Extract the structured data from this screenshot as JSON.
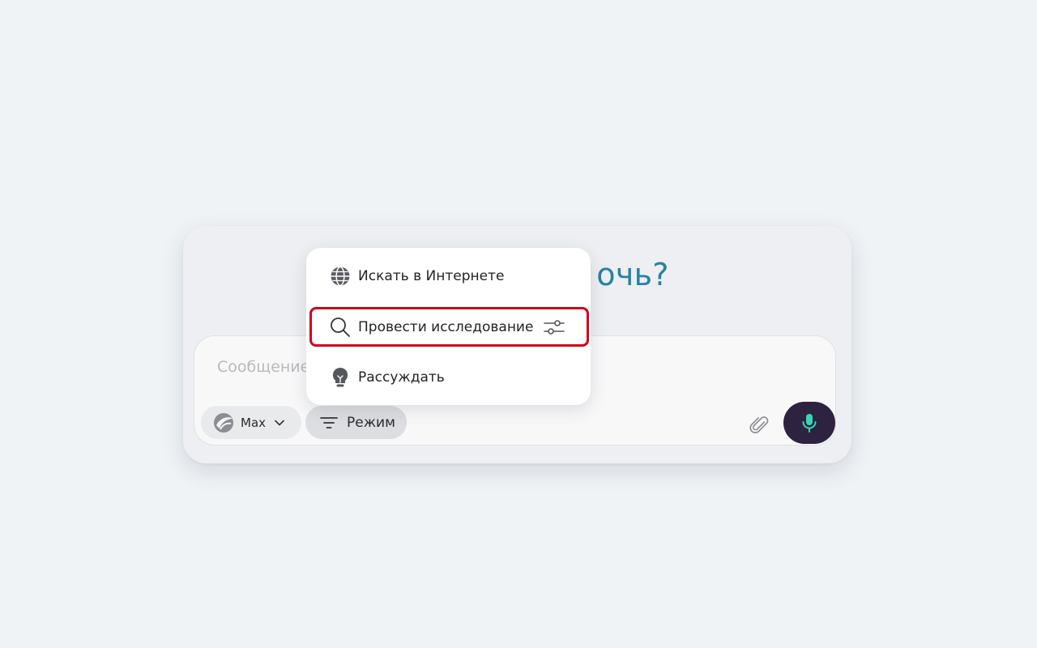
{
  "chat": {
    "headline": "очь?",
    "message_placeholder": "Сообщение",
    "model_label": "Max",
    "mode_label": "Режим"
  },
  "mode_menu": {
    "items": [
      {
        "label": "Искать в Интернете",
        "icon": "globe-icon"
      },
      {
        "label": "Провести исследование",
        "icon": "search-icon",
        "extra_icon": "settings-sliders-icon",
        "highlighted": true
      },
      {
        "label": "Рассуждать",
        "icon": "lightbulb-icon"
      }
    ]
  },
  "colors": {
    "background": "#eff3f6",
    "headline": "#26839f",
    "mic_button": "#2d2340",
    "mic_icon": "#35d8b4",
    "highlight_border": "#d0021b"
  }
}
